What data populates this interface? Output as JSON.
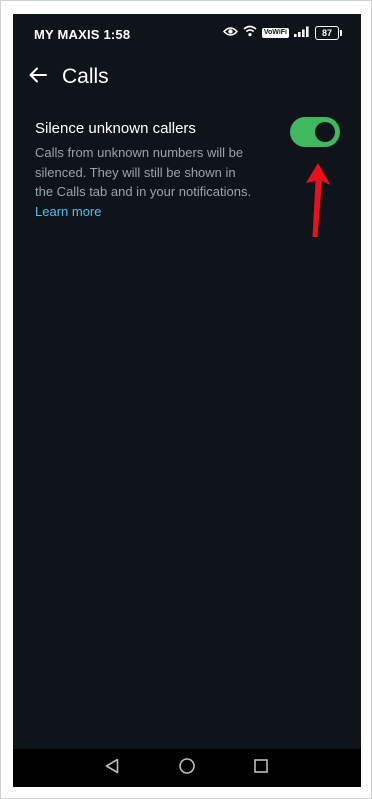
{
  "status_bar": {
    "carrier_time": "MY MAXIS 1:58",
    "vowifi": "VoWiFi",
    "battery": "87",
    "icons": [
      "eye-icon",
      "wifi-icon",
      "signal-icon",
      "battery-icon"
    ]
  },
  "header": {
    "title": "Calls",
    "back_icon": "arrow-left-icon"
  },
  "setting": {
    "title": "Silence unknown callers",
    "description": "Calls from unknown numbers will be silenced. They will still be shown in the Calls tab and in your notifications.",
    "link": "Learn more",
    "toggle_on": true
  },
  "nav_bar": {
    "icons": [
      "back-triangle-icon",
      "home-circle-icon",
      "recents-square-icon"
    ]
  },
  "colors": {
    "background": "#0f141a",
    "toggle_on": "#3fb85f",
    "link": "#53bdeb",
    "annotation_arrow": "#e8101a"
  }
}
